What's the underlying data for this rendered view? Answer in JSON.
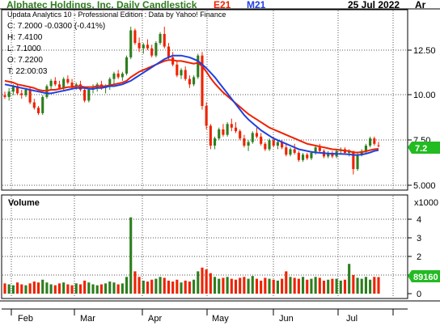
{
  "header": {
    "title": "Alphatec Holdings, Inc. Daily Candlestick",
    "e_label": "E21",
    "m_label": "M21",
    "date": "25 Jul 2022",
    "corner": "Ar"
  },
  "info": {
    "subtitle": "Updata Analytics 10 - Professional Edition : Data by Yahoo! Finance",
    "close": "C: 7.2000  -0.0300 (-0.41%)",
    "high": "H: 7.4100",
    "low": "L: 7.1000",
    "open": "O: 7.2200",
    "time": "T: 22:00:03"
  },
  "price_axis": {
    "ticks": [
      "12.50",
      "10.00",
      "7.50",
      "5.000"
    ],
    "last_label": "7.2"
  },
  "volume_panel": {
    "label": "Volume",
    "multiplier": "x1000",
    "ticks": [
      "4",
      "3",
      "2",
      "1",
      "0"
    ],
    "last_label": "89160"
  },
  "x_axis": {
    "months": [
      "Feb",
      "Mar",
      "Apr",
      "May",
      "Jun",
      "Jul"
    ]
  },
  "colors": {
    "up": "#2e7d1e",
    "down": "#ee2200",
    "ema": "#ee2200",
    "ma": "#2040e0",
    "title": "#2e7d1e",
    "e_label": "#ee2200",
    "m_label": "#2040e0",
    "last_badge": "#22bb22"
  },
  "chart_data": [
    {
      "type": "candlestick",
      "title": "Alphatec Holdings, Inc. Daily Candlestick",
      "ylim": [
        4.8,
        14.8
      ],
      "y_ticks": [
        5.0,
        7.5,
        10.0,
        12.5
      ],
      "x_months": [
        "Feb",
        "Mar",
        "Apr",
        "May",
        "Jun",
        "Jul"
      ],
      "ohlc": [
        [
          10.0,
          10.2,
          9.8,
          9.9
        ],
        [
          9.9,
          10.4,
          9.7,
          10.2
        ],
        [
          10.2,
          10.6,
          10.0,
          10.5
        ],
        [
          10.5,
          10.6,
          10.0,
          10.1
        ],
        [
          10.1,
          10.3,
          9.8,
          10.0
        ],
        [
          10.0,
          10.4,
          9.9,
          10.3
        ],
        [
          10.3,
          10.5,
          9.5,
          9.6
        ],
        [
          9.6,
          9.8,
          9.2,
          9.3
        ],
        [
          9.3,
          9.4,
          8.9,
          9.0
        ],
        [
          9.0,
          10.0,
          8.9,
          9.9
        ],
        [
          9.9,
          10.6,
          9.8,
          10.5
        ],
        [
          10.5,
          10.9,
          10.3,
          10.8
        ],
        [
          10.8,
          11.0,
          10.5,
          10.6
        ],
        [
          10.6,
          10.8,
          10.3,
          10.4
        ],
        [
          10.4,
          11.0,
          10.3,
          10.9
        ],
        [
          10.9,
          11.1,
          10.6,
          10.7
        ],
        [
          10.7,
          10.9,
          10.4,
          10.5
        ],
        [
          10.5,
          10.7,
          10.3,
          10.6
        ],
        [
          10.6,
          10.8,
          10.2,
          10.3
        ],
        [
          10.3,
          10.4,
          9.6,
          9.7
        ],
        [
          9.7,
          10.4,
          9.6,
          10.3
        ],
        [
          10.3,
          10.6,
          10.1,
          10.4
        ],
        [
          10.4,
          10.7,
          10.2,
          10.6
        ],
        [
          10.6,
          10.8,
          10.3,
          10.4
        ],
        [
          10.4,
          10.6,
          10.1,
          10.5
        ],
        [
          10.5,
          11.0,
          10.3,
          10.9
        ],
        [
          10.9,
          11.3,
          10.6,
          11.2
        ],
        [
          11.2,
          11.4,
          10.9,
          11.0
        ],
        [
          11.0,
          11.3,
          10.8,
          11.2
        ],
        [
          11.2,
          12.2,
          11.1,
          12.1
        ],
        [
          12.1,
          13.8,
          12.0,
          13.6
        ],
        [
          13.6,
          13.7,
          12.8,
          12.9
        ],
        [
          12.9,
          13.2,
          12.4,
          12.6
        ],
        [
          12.6,
          12.9,
          12.3,
          12.8
        ],
        [
          12.8,
          13.1,
          12.5,
          12.6
        ],
        [
          12.6,
          12.8,
          12.1,
          12.2
        ],
        [
          12.2,
          13.0,
          12.1,
          12.9
        ],
        [
          12.9,
          13.5,
          12.8,
          13.4
        ],
        [
          13.4,
          13.8,
          12.6,
          12.7
        ],
        [
          12.7,
          12.9,
          12.0,
          12.1
        ],
        [
          12.1,
          12.4,
          11.6,
          11.7
        ],
        [
          11.7,
          11.9,
          11.0,
          11.1
        ],
        [
          11.1,
          11.5,
          10.9,
          11.4
        ],
        [
          11.4,
          11.6,
          10.8,
          10.9
        ],
        [
          10.9,
          11.1,
          10.4,
          10.6
        ],
        [
          10.6,
          11.1,
          10.5,
          11.0
        ],
        [
          11.0,
          12.3,
          10.9,
          12.2
        ],
        [
          12.2,
          12.4,
          9.2,
          9.4
        ],
        [
          9.4,
          9.6,
          8.1,
          8.3
        ],
        [
          8.3,
          8.4,
          7.0,
          7.2
        ],
        [
          7.2,
          7.7,
          7.0,
          7.6
        ],
        [
          7.6,
          8.2,
          7.5,
          8.1
        ],
        [
          8.1,
          8.4,
          7.7,
          7.8
        ],
        [
          7.8,
          8.5,
          7.7,
          8.4
        ],
        [
          8.4,
          8.7,
          8.0,
          8.2
        ],
        [
          8.2,
          8.5,
          7.9,
          8.0
        ],
        [
          8.0,
          8.1,
          7.5,
          7.6
        ],
        [
          7.6,
          7.8,
          7.1,
          7.2
        ],
        [
          7.2,
          7.5,
          6.9,
          7.4
        ],
        [
          7.4,
          8.0,
          7.3,
          7.9
        ],
        [
          7.9,
          8.2,
          7.6,
          7.7
        ],
        [
          7.7,
          7.9,
          7.2,
          7.3
        ],
        [
          7.3,
          7.4,
          6.9,
          7.0
        ],
        [
          7.0,
          7.6,
          6.9,
          7.5
        ],
        [
          7.5,
          7.7,
          7.1,
          7.2
        ],
        [
          7.2,
          7.5,
          7.0,
          7.4
        ],
        [
          7.4,
          7.5,
          7.0,
          7.1
        ],
        [
          7.1,
          7.3,
          6.6,
          6.7
        ],
        [
          6.7,
          7.1,
          6.6,
          7.0
        ],
        [
          7.0,
          7.3,
          6.7,
          6.8
        ],
        [
          6.8,
          6.9,
          6.3,
          6.4
        ],
        [
          6.4,
          6.8,
          6.3,
          6.7
        ],
        [
          6.7,
          6.8,
          6.4,
          6.5
        ],
        [
          6.5,
          6.9,
          6.4,
          6.8
        ],
        [
          6.8,
          7.2,
          6.7,
          7.1
        ],
        [
          7.1,
          7.3,
          6.8,
          6.9
        ],
        [
          6.9,
          7.0,
          6.5,
          6.6
        ],
        [
          6.6,
          6.9,
          6.5,
          6.8
        ],
        [
          6.8,
          6.9,
          6.5,
          6.6
        ],
        [
          6.6,
          7.0,
          6.5,
          6.9
        ],
        [
          6.9,
          7.1,
          6.7,
          7.0
        ],
        [
          7.0,
          7.1,
          6.7,
          6.8
        ],
        [
          6.8,
          7.0,
          6.6,
          6.9
        ],
        [
          6.9,
          6.9,
          5.6,
          5.9
        ],
        [
          5.9,
          6.8,
          5.8,
          6.7
        ],
        [
          6.7,
          7.0,
          6.6,
          6.9
        ],
        [
          6.9,
          7.3,
          6.8,
          7.2
        ],
        [
          7.2,
          7.7,
          7.1,
          7.6
        ],
        [
          7.6,
          7.7,
          7.2,
          7.3
        ],
        [
          7.22,
          7.41,
          7.1,
          7.2
        ]
      ],
      "ema21": [
        10.8,
        10.75,
        10.7,
        10.6,
        10.55,
        10.5,
        10.45,
        10.4,
        10.3,
        10.25,
        10.25,
        10.3,
        10.3,
        10.35,
        10.4,
        10.45,
        10.45,
        10.5,
        10.5,
        10.45,
        10.45,
        10.45,
        10.5,
        10.5,
        10.5,
        10.55,
        10.6,
        10.65,
        10.7,
        10.8,
        11.0,
        11.15,
        11.3,
        11.4,
        11.5,
        11.6,
        11.7,
        11.8,
        11.9,
        11.95,
        11.95,
        11.9,
        11.9,
        11.85,
        11.8,
        11.75,
        11.8,
        11.6,
        11.3,
        10.95,
        10.65,
        10.4,
        10.15,
        9.95,
        9.75,
        9.55,
        9.35,
        9.15,
        8.95,
        8.8,
        8.65,
        8.5,
        8.35,
        8.2,
        8.1,
        8.0,
        7.9,
        7.8,
        7.7,
        7.6,
        7.5,
        7.4,
        7.3,
        7.25,
        7.2,
        7.15,
        7.1,
        7.05,
        7.0,
        6.98,
        6.95,
        6.92,
        6.9,
        6.82,
        6.82,
        6.84,
        6.88,
        6.95,
        7.0,
        7.02
      ],
      "ma21": [
        10.6,
        10.55,
        10.5,
        10.45,
        10.4,
        10.35,
        10.3,
        10.25,
        10.2,
        10.15,
        10.1,
        10.1,
        10.15,
        10.2,
        10.25,
        10.3,
        10.35,
        10.4,
        10.4,
        10.4,
        10.35,
        10.35,
        10.4,
        10.4,
        10.45,
        10.5,
        10.5,
        10.55,
        10.6,
        10.7,
        10.8,
        10.95,
        11.1,
        11.25,
        11.4,
        11.55,
        11.7,
        11.85,
        12.0,
        12.1,
        12.2,
        12.2,
        12.2,
        12.15,
        12.1,
        12.0,
        11.9,
        11.7,
        11.5,
        11.25,
        11.0,
        10.7,
        10.4,
        10.1,
        9.8,
        9.5,
        9.2,
        8.9,
        8.65,
        8.45,
        8.25,
        8.05,
        7.9,
        7.75,
        7.6,
        7.5,
        7.4,
        7.3,
        7.2,
        7.1,
        7.0,
        6.95,
        6.9,
        6.85,
        6.82,
        6.8,
        6.78,
        6.76,
        6.75,
        6.74,
        6.74,
        6.73,
        6.72,
        6.68,
        6.68,
        6.7,
        6.75,
        6.82,
        6.9,
        6.95
      ]
    },
    {
      "type": "bar",
      "title": "Volume",
      "unit": "x1000",
      "ylim": [
        0,
        4.5
      ],
      "y_ticks": [
        0,
        1,
        2,
        3,
        4
      ],
      "values": [
        0.55,
        0.5,
        0.45,
        0.6,
        0.5,
        0.45,
        0.55,
        0.65,
        0.6,
        0.75,
        0.6,
        0.5,
        0.45,
        0.55,
        0.6,
        0.5,
        0.45,
        0.55,
        0.5,
        0.7,
        0.6,
        0.5,
        0.45,
        0.5,
        0.55,
        0.65,
        0.6,
        0.5,
        0.55,
        0.9,
        4.1,
        1.2,
        0.9,
        0.7,
        0.65,
        0.75,
        0.8,
        0.9,
        0.85,
        0.7,
        0.65,
        0.75,
        0.6,
        0.7,
        0.65,
        0.75,
        1.2,
        1.4,
        1.3,
        1.1,
        0.9,
        0.8,
        0.85,
        0.9,
        0.8,
        0.75,
        0.85,
        0.9,
        0.8,
        0.95,
        0.8,
        0.7,
        0.85,
        0.8,
        0.75,
        0.7,
        0.8,
        1.2,
        0.9,
        0.85,
        0.8,
        0.9,
        0.75,
        0.8,
        0.9,
        0.85,
        0.7,
        0.75,
        0.8,
        0.8,
        0.7,
        0.75,
        1.6,
        1.0,
        0.85,
        0.8,
        0.9,
        0.75,
        0.9,
        0.89
      ],
      "up": [
        false,
        true,
        true,
        false,
        false,
        true,
        false,
        false,
        false,
        true,
        true,
        true,
        false,
        false,
        true,
        false,
        false,
        true,
        false,
        false,
        true,
        true,
        true,
        false,
        true,
        true,
        true,
        false,
        true,
        true,
        true,
        false,
        false,
        true,
        false,
        false,
        true,
        true,
        false,
        false,
        false,
        false,
        true,
        false,
        false,
        true,
        true,
        false,
        false,
        false,
        true,
        true,
        false,
        true,
        false,
        false,
        false,
        false,
        true,
        true,
        false,
        false,
        false,
        true,
        false,
        true,
        false,
        false,
        true,
        false,
        false,
        true,
        false,
        true,
        true,
        false,
        false,
        true,
        false,
        true,
        true,
        false,
        true,
        false,
        true,
        true,
        true,
        true,
        false,
        false
      ]
    }
  ]
}
